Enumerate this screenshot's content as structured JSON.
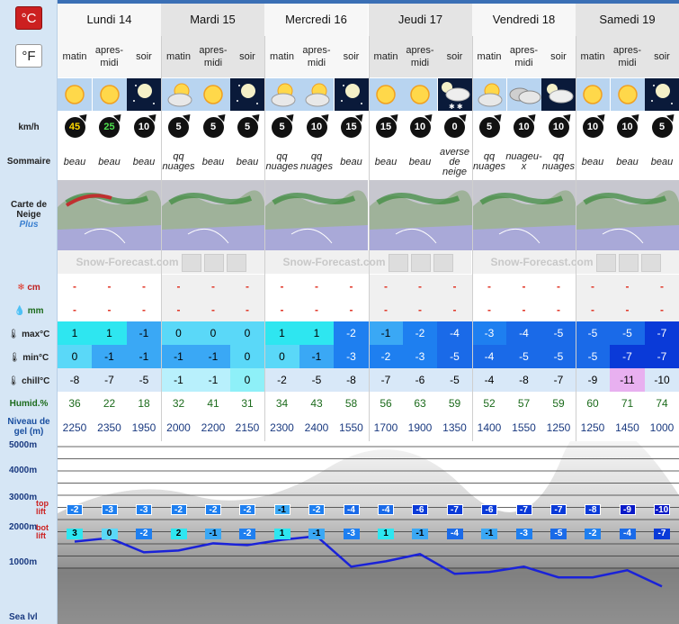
{
  "units": {
    "celsius": "°C",
    "fahrenheit": "°F"
  },
  "row_labels": {
    "wind": "km/h",
    "summary": "Sommaire",
    "snow_map_1": "Carte de",
    "snow_map_2": "Neige",
    "snow_map_plus": "Plus",
    "snow": "cm",
    "rain": "mm",
    "max": "max°C",
    "min": "min°C",
    "chill": "chill°C",
    "humid": "Humid.%",
    "freeze_1": "Niveau de",
    "freeze_2": "gel (m)"
  },
  "elevations": {
    "e5000": "5000m",
    "e4000": "4000m",
    "e3000": "3000m",
    "e2000": "2000m",
    "e1000": "1000m",
    "sea": "Sea lvl"
  },
  "lift_labels": {
    "top_1": "top",
    "top_2": "lift",
    "bot_1": "bot",
    "bot_2": "lift"
  },
  "map_watermark": "Snow-Forecast.com",
  "days": [
    "Lundi 14",
    "Mardi 15",
    "Mercredi 16",
    "Jeudi 17",
    "Vendredi 18",
    "Samedi 19"
  ],
  "periods": {
    "matin": "matin",
    "apres_1": "apres-",
    "apres_2": "midi",
    "soir": "soir"
  },
  "wind": [
    "45",
    "25",
    "10",
    "5",
    "5",
    "5",
    "5",
    "10",
    "15",
    "15",
    "10",
    "0",
    "5",
    "10",
    "10",
    "10",
    "10",
    "5"
  ],
  "summary": [
    "beau",
    "beau",
    "beau",
    "qq nuages",
    "beau",
    "beau",
    "qq nuages",
    "qq nuages",
    "beau",
    "beau",
    "beau",
    "averse de neige",
    "qq nuages",
    "nuageu-x",
    "qq nuages",
    "beau",
    "beau",
    "beau"
  ],
  "snow": [
    "-",
    "-",
    "-",
    "-",
    "-",
    "-",
    "-",
    "-",
    "-",
    "-",
    "-",
    "-",
    "-",
    "-",
    "-",
    "-",
    "-",
    "-"
  ],
  "rain": [
    "-",
    "-",
    "-",
    "-",
    "-",
    "-",
    "-",
    "-",
    "-",
    "-",
    "-",
    "-",
    "-",
    "-",
    "-",
    "-",
    "-",
    "-"
  ],
  "max_c": [
    "1",
    "1",
    "-1",
    "0",
    "0",
    "0",
    "1",
    "1",
    "-2",
    "-1",
    "-2",
    "-4",
    "-3",
    "-4",
    "-5",
    "-5",
    "-5",
    "-7"
  ],
  "min_c": [
    "0",
    "-1",
    "-1",
    "-1",
    "-1",
    "0",
    "0",
    "-1",
    "-3",
    "-2",
    "-3",
    "-5",
    "-4",
    "-5",
    "-5",
    "-5",
    "-7",
    "-7"
  ],
  "chill_c": [
    "-8",
    "-7",
    "-5",
    "-1",
    "-1",
    "0",
    "-2",
    "-5",
    "-8",
    "-7",
    "-6",
    "-5",
    "-4",
    "-8",
    "-7",
    "-9",
    "-11",
    "-10"
  ],
  "humid": [
    "36",
    "22",
    "18",
    "32",
    "41",
    "31",
    "34",
    "43",
    "58",
    "56",
    "63",
    "59",
    "52",
    "57",
    "59",
    "60",
    "71",
    "74"
  ],
  "freeze": [
    "2250",
    "2350",
    "1950",
    "2000",
    "2200",
    "2150",
    "2300",
    "2400",
    "1550",
    "1700",
    "1900",
    "1350",
    "1400",
    "1550",
    "1250",
    "1250",
    "1450",
    "1000"
  ],
  "top_lift": [
    "-2",
    "-3",
    "-3",
    "-2",
    "-2",
    "-2",
    "-1",
    "-2",
    "-4",
    "-4",
    "-6",
    "-7",
    "-6",
    "-7",
    "-7",
    "-8",
    "-9",
    "-10"
  ],
  "bot_lift": [
    "3",
    "0",
    "-2",
    "2",
    "-1",
    "-2",
    "1",
    "-1",
    "-3",
    "1",
    "-1",
    "-4",
    "-1",
    "-3",
    "-5",
    "-2",
    "-4",
    "-7"
  ],
  "icons": [
    "sun",
    "sun",
    "moon",
    "partly",
    "sun",
    "moon",
    "partly",
    "partly",
    "moon",
    "sun",
    "sun",
    "snow-night",
    "partly",
    "cloudy",
    "cloud-night",
    "sun",
    "sun",
    "moon"
  ]
}
